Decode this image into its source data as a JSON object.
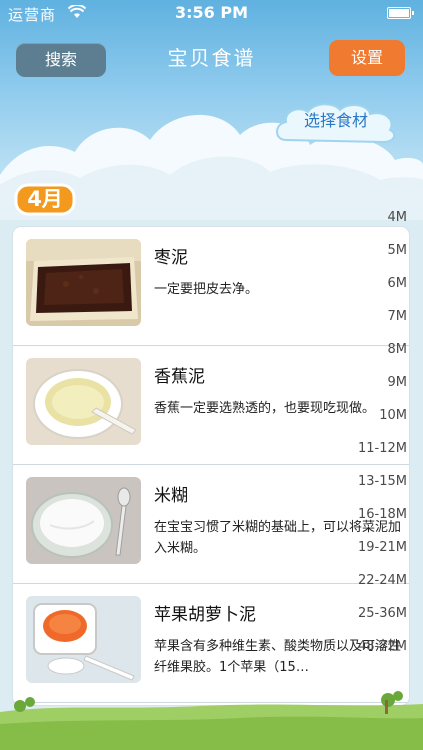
{
  "status_bar": {
    "carrier": "运营商",
    "time": "3:56 PM",
    "battery_level": 1.0
  },
  "navbar": {
    "title": "宝贝食谱",
    "search_label": "搜索",
    "settings_label": "设置"
  },
  "ingredient_button": {
    "label": "选择食材"
  },
  "month_badge": {
    "label": "4月"
  },
  "recipes": [
    {
      "title": "枣泥",
      "desc": "一定要把皮去净。"
    },
    {
      "title": "香蕉泥",
      "desc": "香蕉一定要选熟透的，也要现吃现做。"
    },
    {
      "title": "米糊",
      "desc": "在宝宝习惯了米糊的基础上，可以将菜泥加入米糊。"
    },
    {
      "title": "苹果胡萝卜泥",
      "desc": "苹果含有多种维生素、酸类物质以及可溶性纤维果胶。1个苹果（15…"
    }
  ],
  "month_index": [
    "4M",
    "5M",
    "6M",
    "7M",
    "8M",
    "9M",
    "10M",
    "11-12M",
    "13-15M",
    "16-18M",
    "19-21M",
    "22-24M",
    "25-36M",
    "48-72M"
  ],
  "colors": {
    "sky_top": "#5fb1e0",
    "search_button": "#5d7e90",
    "settings_button": "#f07a30",
    "month_badge": "#f39a1e",
    "ingredient_text": "#2a79c8"
  }
}
